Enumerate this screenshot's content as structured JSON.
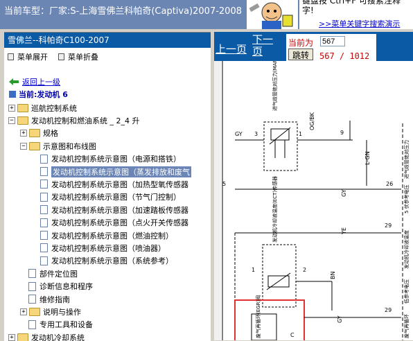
{
  "header": {
    "vehicle": "当前车型：厂家:S-上海雪佛兰科帕奇(Captiva)2007-2008"
  },
  "tip": {
    "text_line1": "键盘按 Ctrl+F 可搜索注释",
    "text_line2": "字!",
    "link": ">>菜单关键字搜索演示"
  },
  "left": {
    "title": "雪佛兰--科帕奇C100-2007",
    "expand_all": "菜单展开",
    "collapse_all": "菜单折叠",
    "back": "返回上一级",
    "current": "当前:发动机 6",
    "tree": [
      {
        "label": "巡航控制系统",
        "type": "folder",
        "exp": "+"
      },
      {
        "label": "发动机控制和燃油系统 _ 2_4 升",
        "type": "folder-open",
        "exp": "−"
      },
      {
        "label": "规格",
        "type": "folder",
        "exp": "+"
      },
      {
        "label": "示意图和布线图",
        "type": "folder-open",
        "exp": "−"
      },
      {
        "label": "发动机控制系统示意图（电源和搭铁）",
        "type": "doc"
      },
      {
        "label": "发动机控制系统示意图（蒸发排放和废气",
        "type": "doc",
        "selected": true
      },
      {
        "label": "发动机控制系统示意图（加热型氧传感器",
        "type": "doc"
      },
      {
        "label": "发动机控制系统示意图（节气门控制）",
        "type": "doc"
      },
      {
        "label": "发动机控制系统示意图（加速踏板传感器",
        "type": "doc"
      },
      {
        "label": "发动机控制系统示意图（点火开关传感器",
        "type": "doc"
      },
      {
        "label": "发动机控制系统示意图（燃油控制）",
        "type": "doc"
      },
      {
        "label": "发动机控制系统示意图（喷油器）",
        "type": "doc"
      },
      {
        "label": "发动机控制系统示意图（系统参考）",
        "type": "doc"
      },
      {
        "label": "部件定位图",
        "type": "doc"
      },
      {
        "label": "诊断信息和程序",
        "type": "doc"
      },
      {
        "label": "维修指南",
        "type": "doc"
      },
      {
        "label": "说明与操作",
        "type": "folder",
        "exp": "+"
      },
      {
        "label": "专用工具和设备",
        "type": "doc"
      },
      {
        "label": "发动机冷却系统",
        "type": "folder",
        "exp": "+"
      }
    ]
  },
  "right": {
    "prev": "上一页",
    "next": "下一页",
    "current_label": "当前为",
    "page_input": "567",
    "jump": "跳转",
    "page_count": "567 / 1012"
  },
  "diagram": {
    "wires": {
      "gy1": "GY",
      "ogbk": "OG/BK",
      "lgn": "L-GN",
      "gy2": "GY",
      "ye": "YE",
      "bn": "BN",
      "gy3": "GY"
    },
    "pins": {
      "p3": "3",
      "p9": "9",
      "p1a": "1",
      "p5": "5",
      "p26": "26",
      "p29": "29",
      "p1b": "1",
      "p2": "2",
      "p29b": "29",
      "pc": "C"
    },
    "components": {
      "map": "进气歧管绝对压力(MAP)传感器",
      "ect": "发动机冷却液温度(ECT)传感器",
      "egr": "废气再循环(EGR)阀",
      "right1": "进气歧管绝对压力",
      "right2": "5 伏参考电压",
      "right3": "发动机冷却液温度",
      "right4": "低参考电压",
      "right5": "废气再循环"
    }
  },
  "colors": {
    "blue_bar": "#0a5aa5",
    "title_bg": "#6c86b4",
    "highlight_box": "#e03030"
  }
}
